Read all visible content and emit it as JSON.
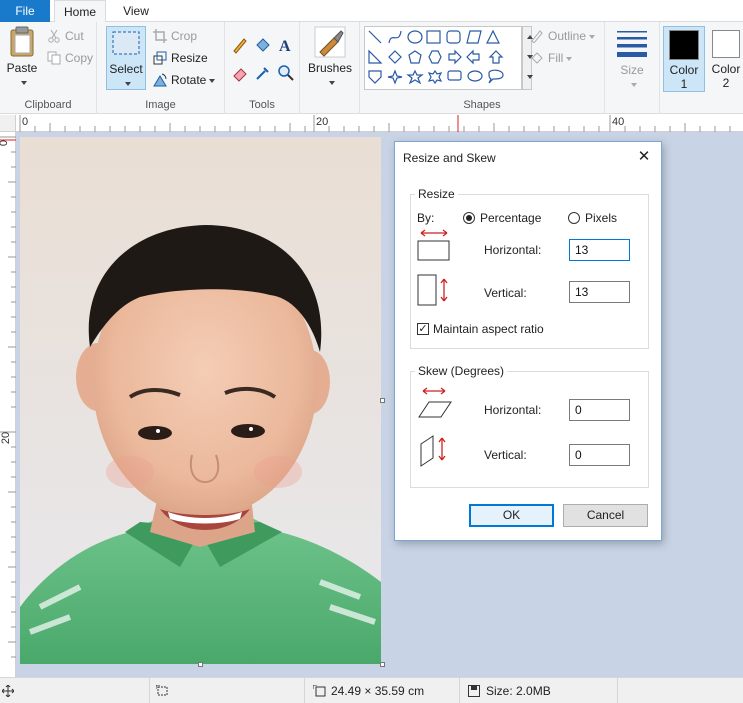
{
  "tabs": {
    "file": "File",
    "home": "Home",
    "view": "View"
  },
  "clipboard": {
    "paste": "Paste",
    "cut": "Cut",
    "copy": "Copy",
    "label": "Clipboard"
  },
  "image": {
    "select": "Select",
    "crop": "Crop",
    "resize": "Resize",
    "rotate": "Rotate",
    "label": "Image"
  },
  "tools": {
    "label": "Tools"
  },
  "brushes": {
    "label": "Brushes"
  },
  "shapes": {
    "outline": "Outline",
    "fill": "Fill",
    "label": "Shapes"
  },
  "size": {
    "label": "Size"
  },
  "colors": {
    "color1_line1": "Color",
    "color1_line2": "1",
    "color2_line1": "Color",
    "color2_line2": "2",
    "color1_value": "#000000",
    "color2_value": "#ffffff"
  },
  "ruler": {
    "top": [
      "0",
      "20",
      "40"
    ],
    "left": [
      "0",
      "20"
    ]
  },
  "status": {
    "dimensions": "24.49 × 35.59 cm",
    "size": "Size: 2.0MB"
  },
  "dialog": {
    "title": "Resize and Skew",
    "resize_group": "Resize",
    "by_label": "By:",
    "percentage": "Percentage",
    "pixels": "Pixels",
    "resize_h_label": "Horizontal:",
    "resize_h_value": "13",
    "resize_v_label": "Vertical:",
    "resize_v_value": "13",
    "maintain_aspect": "Maintain aspect ratio",
    "skew_group": "Skew (Degrees)",
    "skew_h_label": "Horizontal:",
    "skew_h_value": "0",
    "skew_v_label": "Vertical:",
    "skew_v_value": "0",
    "ok": "OK",
    "cancel": "Cancel"
  }
}
